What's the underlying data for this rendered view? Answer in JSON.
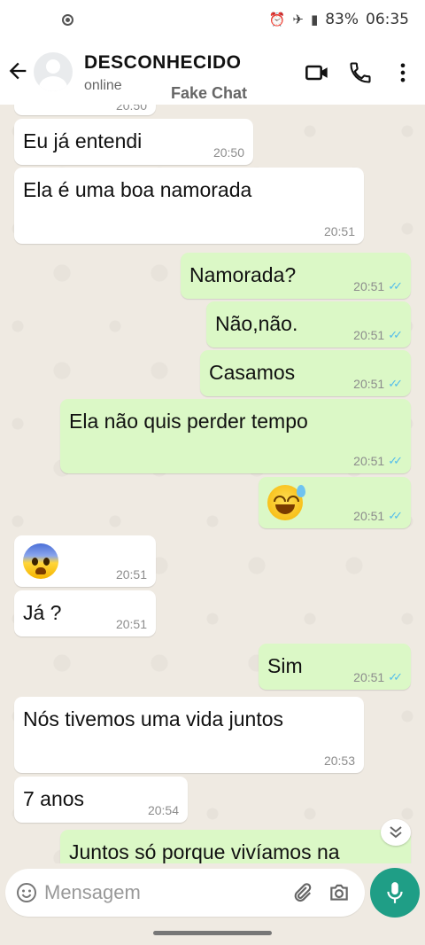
{
  "status_bar": {
    "battery": "83%",
    "time": "06:35"
  },
  "header": {
    "contact_name": "DESCONHECIDO",
    "presence": "online",
    "watermark": "Fake Chat",
    "icons": [
      "back-arrow-icon",
      "avatar",
      "video-call-icon",
      "phone-icon",
      "more-vert-icon"
    ]
  },
  "chat": {
    "partial_top_time": "20:50",
    "messages": [
      {
        "dir": "in",
        "text": "Eu já entendi",
        "time": "20:50"
      },
      {
        "dir": "in",
        "text": "Ela é uma boa namorada",
        "time": "20:51"
      },
      {
        "dir": "out",
        "text": "Namorada?",
        "time": "20:51"
      },
      {
        "dir": "out",
        "text": "Não,não.",
        "time": "20:51"
      },
      {
        "dir": "out",
        "text": "Casamos",
        "time": "20:51"
      },
      {
        "dir": "out",
        "text": "Ela não quis perder tempo",
        "time": "20:51"
      },
      {
        "dir": "out",
        "emoji": "grinning-face-with-sweat",
        "time": "20:51"
      },
      {
        "dir": "in",
        "emoji": "anxious-face-with-sweat",
        "time": "20:51"
      },
      {
        "dir": "in",
        "text": "Já ?",
        "time": "20:51"
      },
      {
        "dir": "out",
        "text": "Sim",
        "time": "20:51"
      },
      {
        "dir": "in",
        "text": "Nós tivemos uma vida juntos",
        "time": "20:53"
      },
      {
        "dir": "in",
        "text": "7 anos",
        "time": "20:54"
      },
      {
        "dir": "out",
        "text": "Juntos só porque vivíamos na",
        "time": ""
      }
    ],
    "read_ticks": "✓✓"
  },
  "composer": {
    "placeholder": "Mensagem"
  },
  "colors": {
    "incoming": "#ffffff",
    "outgoing": "#dbf8c6",
    "wallpaper": "#efeae2",
    "ticks": "#53bdeb",
    "accent": "#1f9e86"
  }
}
